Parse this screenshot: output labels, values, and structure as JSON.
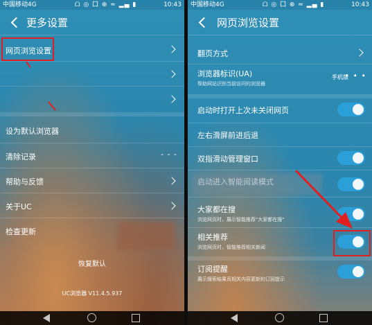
{
  "status_bar": {
    "carrier": "中国移动4G",
    "icons": "ᗝ ◎ 囗 ⊕ ≈ ▂▄ ▮",
    "time": "10:43"
  },
  "left": {
    "title": "更多设置",
    "items": [
      {
        "label": "网页浏览设置"
      },
      {
        "label": ""
      },
      {
        "label": ""
      },
      {
        "label": "设为默认浏览器"
      },
      {
        "label": "清除记录",
        "dots": "- - -"
      },
      {
        "label": "帮助与反馈"
      },
      {
        "label": "关于UC"
      },
      {
        "label": "检查更新"
      }
    ],
    "restore_label": "恢复默认",
    "version": "UC浏览器 V11.4.5.937"
  },
  "right": {
    "title": "网页浏览设置",
    "items": [
      {
        "label": "翻页方式"
      },
      {
        "label": "浏览器标识(UA)",
        "sub": "帮助网站识别当前访问的浏览器",
        "value": "手机版",
        "dots": "• • •"
      },
      {
        "label": "启动时打开上次未关闭网页",
        "toggle": true
      },
      {
        "label": "左右滑屏前进后退"
      },
      {
        "label": "双指滑动管理窗口",
        "toggle": true
      },
      {
        "label": "启动进入智能阅读模式",
        "toggle": true
      },
      {
        "label": "大家都在搜",
        "sub": "浏览网页时，展示智能推荐\"大家都在搜\"",
        "toggle": true
      },
      {
        "label": "相关推荐",
        "sub": "浏览网页时，智能推荐相关新闻",
        "toggle": true
      },
      {
        "label": "订阅提醒",
        "sub": "展示搜索结果页相关内容更新的订阅提示",
        "toggle": true
      }
    ]
  },
  "colors": {
    "accent": "#2a9fd8",
    "highlight": "#e02020"
  }
}
